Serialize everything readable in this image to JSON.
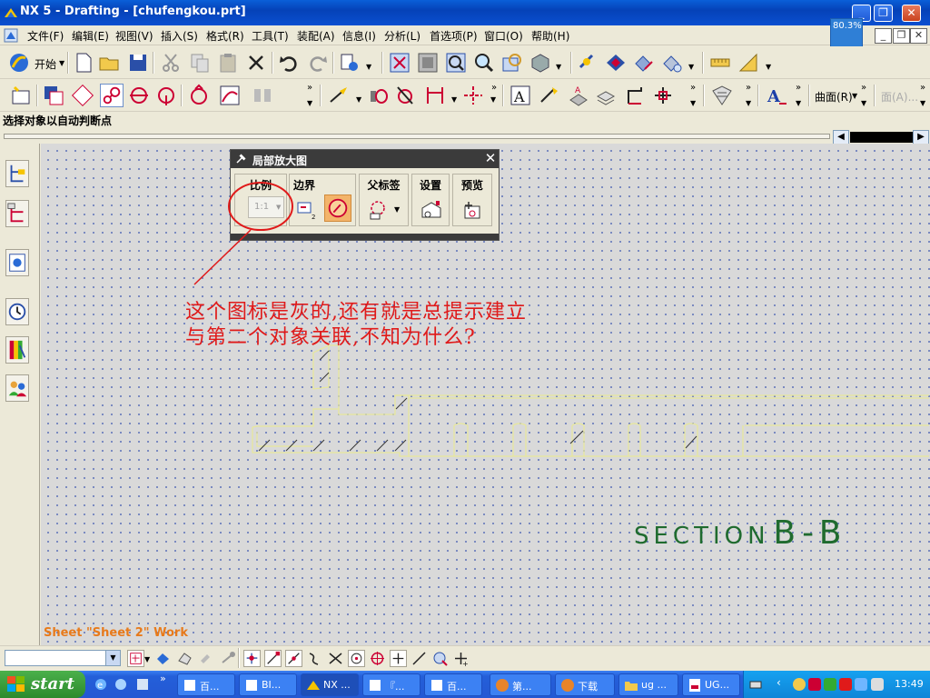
{
  "window": {
    "title": "NX 5 - Drafting - [chufengkou.prt]"
  },
  "menubar": {
    "items": [
      "文件(F)",
      "编辑(E)",
      "视图(V)",
      "插入(S)",
      "格式(R)",
      "工具(T)",
      "装配(A)",
      "信息(I)",
      "分析(L)",
      "首选项(P)",
      "窗口(O)",
      "帮助(H)"
    ]
  },
  "zoom_badge": "80.3%",
  "toolbar": {
    "start_label": "开始",
    "surface_label": "曲面(R)",
    "face_label": "面(A)..."
  },
  "cue_line": "选择对象以自动判断点",
  "dialog": {
    "title": "局部放大图",
    "groups": {
      "scale": "比例",
      "boundary": "边界",
      "parent_label": "父标签",
      "settings": "设置",
      "preview": "预览"
    },
    "scale_value": "1:1"
  },
  "annotation": {
    "line1": "这个图标是灰的,还有就是总提示建立",
    "line2": "与第二个对象关联,不知为什么?"
  },
  "section_label": {
    "word": "SECTION",
    "letters": "B-B"
  },
  "sheet_label": "Sheet \"Sheet 2\" Work",
  "taskbar": {
    "start": "start",
    "items": [
      "百...",
      "BI...",
      "NX ...",
      "『...",
      "百...",
      "第...",
      "下载",
      "ug ...",
      "UG..."
    ],
    "clock": "13:49"
  },
  "colors": {
    "annotation": "#e01a1a",
    "section": "#1f6b2e",
    "sheet_label": "#e87a1a",
    "geometry": "#e8e89a"
  }
}
